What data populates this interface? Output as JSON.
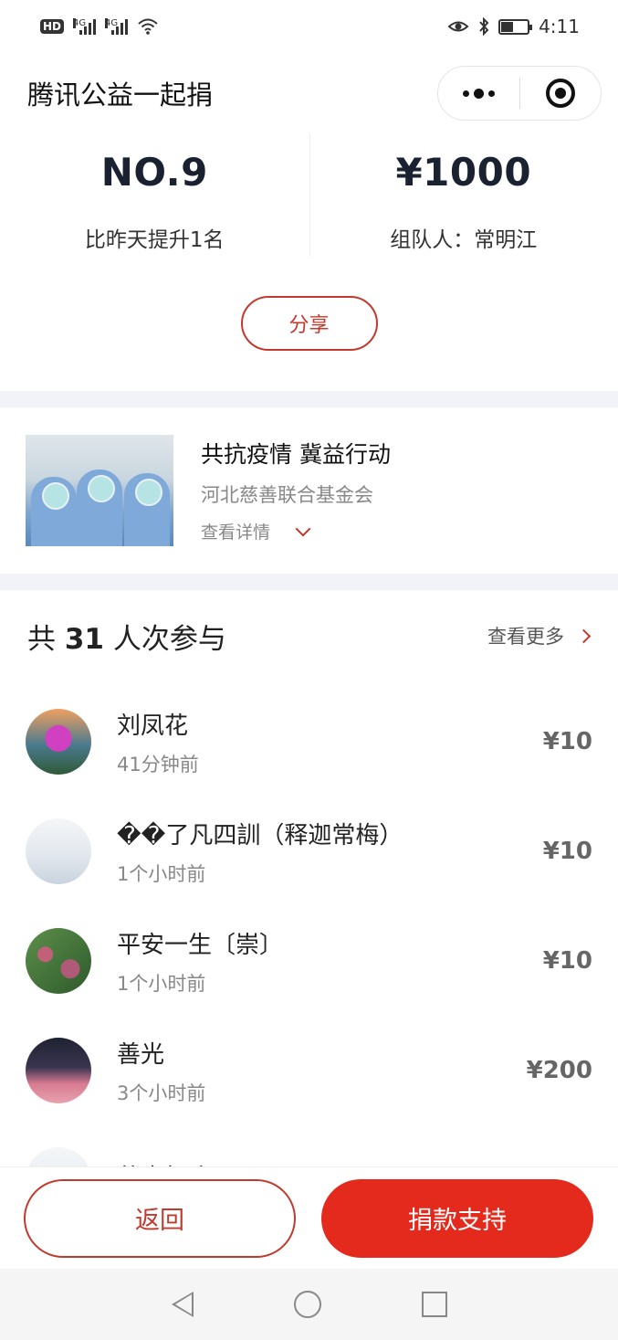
{
  "status_bar": {
    "hd_label": "HD",
    "net1": "4G",
    "net2": "4G",
    "time": "4:11",
    "battery_level": 0.45
  },
  "nav": {
    "title": "腾讯公益一起捐"
  },
  "stats": {
    "rank_value": "NO.9",
    "rank_sub": "比昨天提升1名",
    "amount_value": "¥1000",
    "organizer": "组队人：常明江"
  },
  "share_label": "分享",
  "project": {
    "title": "共抗疫情 冀益行动",
    "org": "河北慈善联合基金会",
    "detail_label": "查看详情"
  },
  "participants": {
    "count_prefix": "共",
    "count": "31",
    "count_suffix": "人次参与",
    "see_more_label": "查看更多",
    "items": [
      {
        "name": "刘凤花",
        "time": "41分钟前",
        "amount": "¥10"
      },
      {
        "name": "��了凡四訓（释迦常梅）",
        "time": "1个小时前",
        "amount": "¥10"
      },
      {
        "name": "平安一生〔崇〕",
        "time": "1个小时前",
        "amount": "¥10"
      },
      {
        "name": "善光",
        "time": "3个小时前",
        "amount": "¥200"
      },
      {
        "name": "萍水相逢",
        "time": "",
        "amount": ""
      }
    ]
  },
  "bottom": {
    "back_label": "返回",
    "donate_label": "捐款支持"
  },
  "colors": {
    "accent": "#c23a2e",
    "donate": "#e32a1d",
    "divider_band": "#f1f3f8"
  }
}
